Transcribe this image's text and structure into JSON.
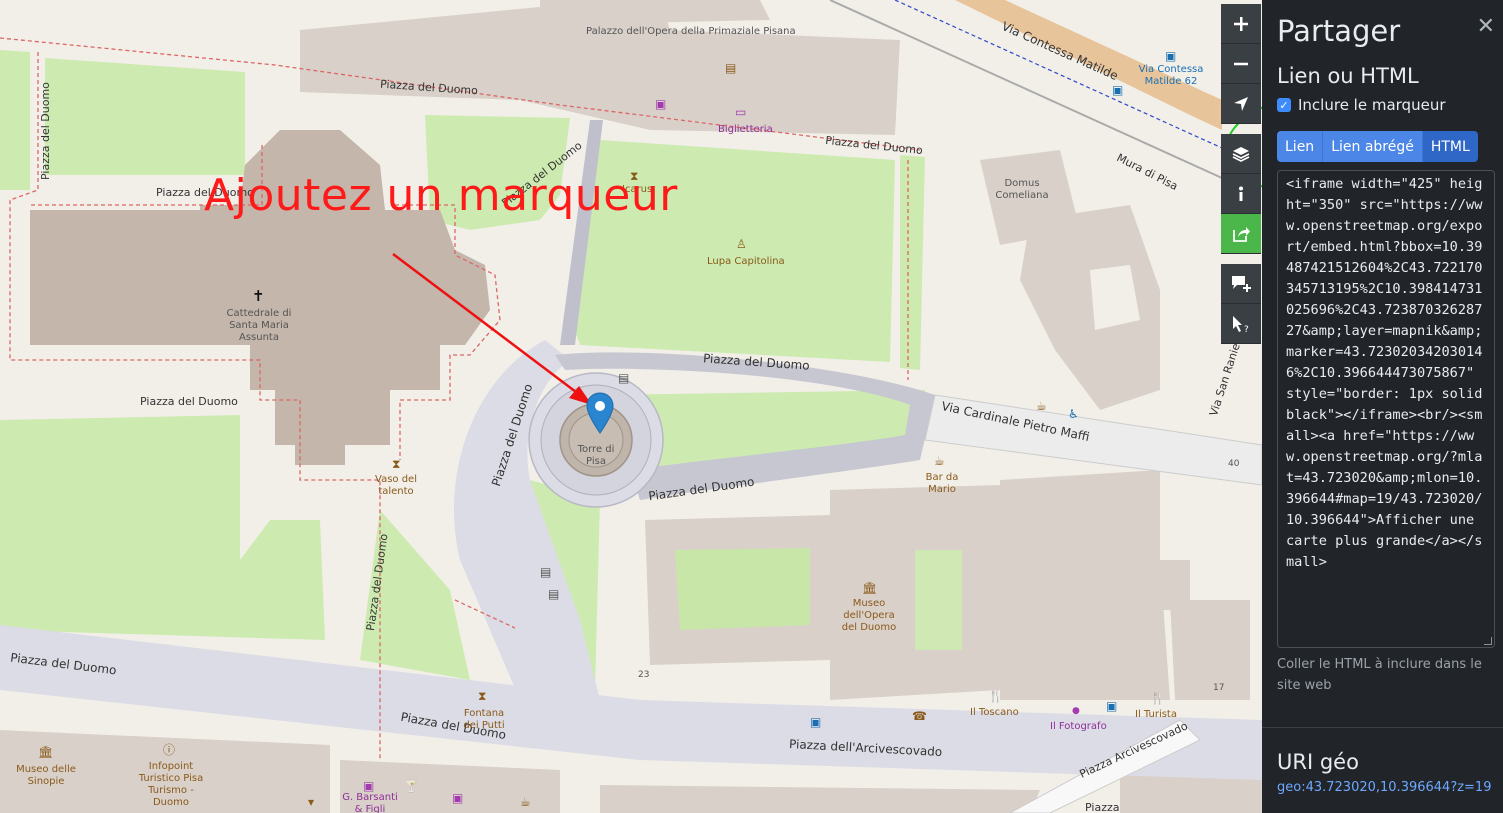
{
  "annotation": {
    "text": "Ajoutez un marqueur",
    "color": "#ff1a1a"
  },
  "map": {
    "streets": {
      "piazza_del_duomo": "Piazza del Duomo",
      "via_contessa_matilde": "Via Contessa Matilde",
      "mura_di_pisa": "Mura di Pisa",
      "via_cardinale": "Via Cardinale Pietro Maffi",
      "via_san_ranieri": "Via San Ranieri",
      "piazza_arcivescovado": "Piazza dell'Arcivescovado",
      "piazza_arcivescovado_2": "Piazza Arcivescovado",
      "piazza": "Piazza"
    },
    "places": {
      "palazzo": "Palazzo dell'Opera della Primaziale Pisana",
      "biglietteria": "Biglietteria",
      "icarus": "Icarus",
      "lupa": "Lupa Capitolina",
      "cattedrale": "Cattedrale di Santa Maria Assunta",
      "torre": "Torre di Pisa",
      "vaso": "Vaso del talento",
      "domus": "Domus Comeliana",
      "bar": "Bar da Mario",
      "museo_opera": "Museo dell'Opera del Duomo",
      "fontana": "Fontana dei Putti",
      "museo_sinopie": "Museo delle Sinopie",
      "infopoint": "Infopoint Turistico Pisa Turismo - Duomo",
      "toscano": "Il Toscano",
      "fotografo": "Il Fotografo",
      "turista": "Il Turista",
      "barsanti": "G. Barsanti & Figli",
      "bus_stop": "Via Contessa Matilde 62"
    },
    "house_numbers": [
      "23",
      "40",
      "17"
    ]
  },
  "controls": [
    {
      "name": "zoom-in-button",
      "icon": "plus-icon"
    },
    {
      "name": "zoom-out-button",
      "icon": "minus-icon"
    },
    {
      "name": "locate-button",
      "icon": "location-arrow-icon"
    },
    {
      "name": "layers-button",
      "icon": "layers-icon"
    },
    {
      "name": "info-button",
      "icon": "info-icon"
    },
    {
      "name": "share-button",
      "icon": "share-icon",
      "active": true
    },
    {
      "name": "add-note-button",
      "icon": "add-note-icon"
    },
    {
      "name": "query-features-button",
      "icon": "query-cursor-icon"
    }
  ],
  "sidebar": {
    "title": "Partager",
    "section_link_title": "Lien ou HTML",
    "include_marker_label": "Inclure le marqueur",
    "include_marker_checked": true,
    "tabs": [
      "Lien",
      "Lien abrégé",
      "HTML"
    ],
    "active_tab": "HTML",
    "html_code": "<iframe width=\"425\" height=\"350\" src=\"https://www.openstreetmap.org/export/embed.html?bbox=10.39487421512604%2C43.722170345713195%2C10.398414731025696%2C43.72387032628727&amp;layer=mapnik&amp;marker=43.723020342030146%2C10.396644473075867\" style=\"border: 1px solid black\"></iframe><br/><small><a href=\"https://www.openstreetmap.org/?mlat=43.723020&amp;mlon=10.396644#map=19/43.723020/10.396644\">Afficher une carte plus grande</a></small>",
    "help_text": "Coller le HTML à inclure dans le site web",
    "geo_title": "URI géo",
    "geo_link": "geo:43.723020,10.396644?z=19"
  },
  "colors": {
    "sidebar_bg": "#212529",
    "button_blue": "#4c86e6",
    "share_active": "#4bb74a",
    "marker_blue": "#2a85d0",
    "ellipse_green": "#22cc22"
  }
}
